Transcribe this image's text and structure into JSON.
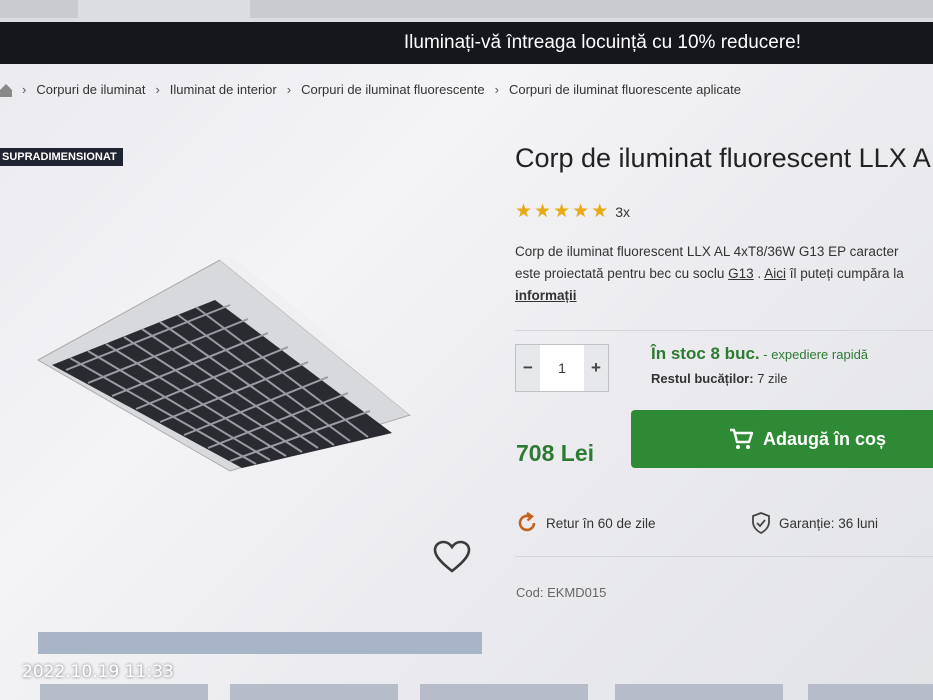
{
  "banner": {
    "text": "Iluminați-vă întreaga locuință cu 10% reducere!"
  },
  "breadcrumb": {
    "items": [
      "Corpuri de iluminat",
      "Iluminat de interior",
      "Corpuri de iluminat fluorescente",
      "Corpuri de iluminat fluorescente aplicate"
    ]
  },
  "badge": "SUPRADIMENSIONAT",
  "product": {
    "title": "Corp de iluminat fluorescent LLX A",
    "rating": 5,
    "review_count": "3x",
    "description_line1": "Corp de iluminat fluorescent LLX AL 4xT8/36W G13 EP caracter",
    "description_line2_pre": "este proiectată pentru bec cu soclu ",
    "description_link1": "G13",
    "description_sep": " . ",
    "description_link2": "Aici",
    "description_line2_post": " îl puteți cumpăra la",
    "more_info_link": "informații"
  },
  "quantity": {
    "minus": "−",
    "value": "1",
    "plus": "+"
  },
  "stock": {
    "status": "În stoc 8 buc.",
    "shipping": " - expediere rapidă",
    "rest_label": "Restul bucăților:",
    "rest_value": " 7 zile"
  },
  "price": "708 Lei",
  "cart_button": "Adaugă în coș",
  "features": {
    "return": "Retur în 60 de zile",
    "warranty": "Garanție: 36 luni"
  },
  "code": "Cod: EKMD015",
  "timestamp": "2022.10.19 11:33",
  "colors": {
    "accent_green": "#2f8a35",
    "banner_bg": "#15171d",
    "star": "#e8a916",
    "return_icon": "#c4621c"
  }
}
